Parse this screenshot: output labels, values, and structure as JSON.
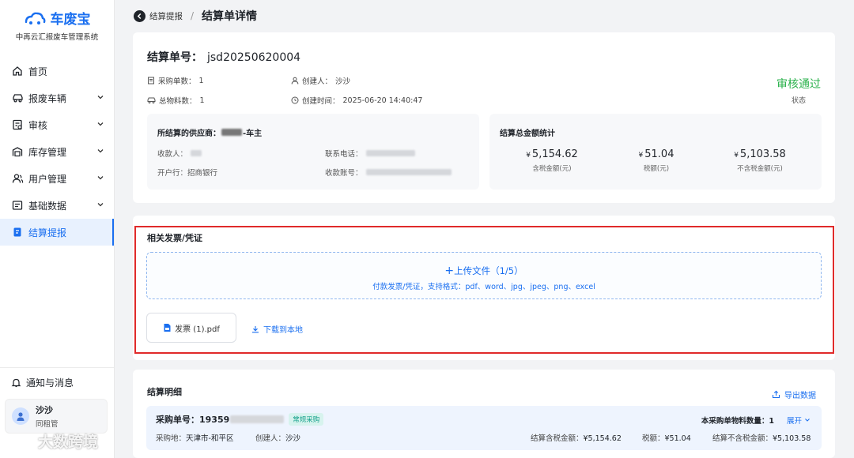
{
  "app": {
    "name": "车废宝",
    "subtitle": "中再云汇报废车管理系统",
    "brand_color": "#1a6ff0"
  },
  "sidebar": {
    "items": [
      {
        "label": "首页",
        "icon": "home-icon",
        "has_children": false
      },
      {
        "label": "报废车辆",
        "icon": "car-icon",
        "has_children": true
      },
      {
        "label": "审核",
        "icon": "audit-icon",
        "has_children": true
      },
      {
        "label": "库存管理",
        "icon": "warehouse-icon",
        "has_children": true
      },
      {
        "label": "用户管理",
        "icon": "users-icon",
        "has_children": true
      },
      {
        "label": "基础数据",
        "icon": "data-icon",
        "has_children": true
      },
      {
        "label": "结算提报",
        "icon": "settlement-icon",
        "has_children": false,
        "active": true
      }
    ],
    "notice": "通知与消息",
    "user": {
      "name": "沙沙",
      "role": "同租管"
    },
    "watermark": "大数跨境"
  },
  "breadcrumb": {
    "parent": "结算提报",
    "current": "结算单详情"
  },
  "settlement": {
    "number_label": "结算单号：",
    "number": "jsd20250620004",
    "purchase_count_label": "采购单数：",
    "purchase_count": "1",
    "material_count_label": "总物料数：",
    "material_count": "1",
    "creator_label": "创建人：",
    "creator": "沙沙",
    "created_time_label": "创建时间：",
    "created_time": "2025-06-20 14:40:47",
    "status": "审核通过",
    "status_label": "状态",
    "status_color": "#2bb24c"
  },
  "supplier": {
    "title_prefix": "所结算的供应商：",
    "title_suffix": "-车主",
    "payee_label": "收款人：",
    "bank_label": "开户行：",
    "bank": "招商银行",
    "phone_label": "联系电话：",
    "account_label": "收款账号："
  },
  "amounts": {
    "title": "结算总金额统计",
    "items": [
      {
        "value": "5,154.62",
        "currency": "¥",
        "label": "含税金额(元)"
      },
      {
        "value": "51.04",
        "currency": "¥",
        "label": "税额(元)"
      },
      {
        "value": "5,103.58",
        "currency": "¥",
        "label": "不含税金额(元)"
      }
    ]
  },
  "invoices": {
    "title": "相关发票/凭证",
    "upload_label": "上传文件（1/5）",
    "upload_hint": "付款发票/凭证，支持格式：pdf、word、jpg、jpeg、png、excel",
    "file_name": "发票 (1).pdf",
    "download_label": "下载到本地"
  },
  "details": {
    "title": "结算明细",
    "export_label": "导出数据",
    "row": {
      "order_label": "采购单号：",
      "order_prefix": "19359",
      "tag": "常规采购",
      "location_label": "采购地：",
      "location": "天津市-和平区",
      "creator_label": "创建人：",
      "creator": "沙沙",
      "qty_label": "本采购单物料数量：",
      "qty": "1",
      "expand_label": "展开",
      "taxed_label": "结算含税金额：",
      "taxed": "¥5,154.62",
      "tax_label": "税额：",
      "tax": "¥51.04",
      "untaxed_label": "结算不含税金额：",
      "untaxed": "¥5,103.58"
    }
  }
}
